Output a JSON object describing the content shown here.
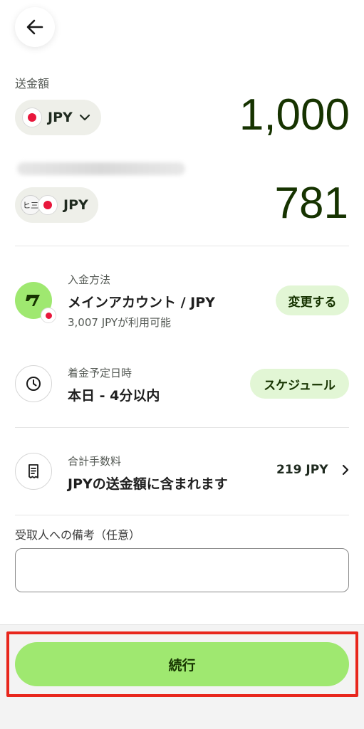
{
  "send": {
    "label": "送金額",
    "currency": "JPY",
    "amount": "1,000"
  },
  "receive": {
    "recipient_initials": "ヒ三",
    "currency": "JPY",
    "amount": "781"
  },
  "payment_method": {
    "label": "入金方法",
    "title": "メインアカウント / JPY",
    "sub": "3,007 JPYが利用可能",
    "action": "変更する"
  },
  "arrival": {
    "label": "着金予定日時",
    "title": "本日 - 4分以内",
    "action": "スケジュール"
  },
  "fees": {
    "label": "合計手数料",
    "title": "JPYの送金額に含まれます",
    "value": "219 JPY"
  },
  "note": {
    "label": "受取人への備考（任意）",
    "value": "",
    "placeholder": ""
  },
  "continue_button": "続行",
  "colors": {
    "accent": "#9fe870",
    "accent_light": "#e2f6d5",
    "forest": "#163300",
    "highlight": "#e8261c",
    "flag_red": "#e8173c"
  }
}
